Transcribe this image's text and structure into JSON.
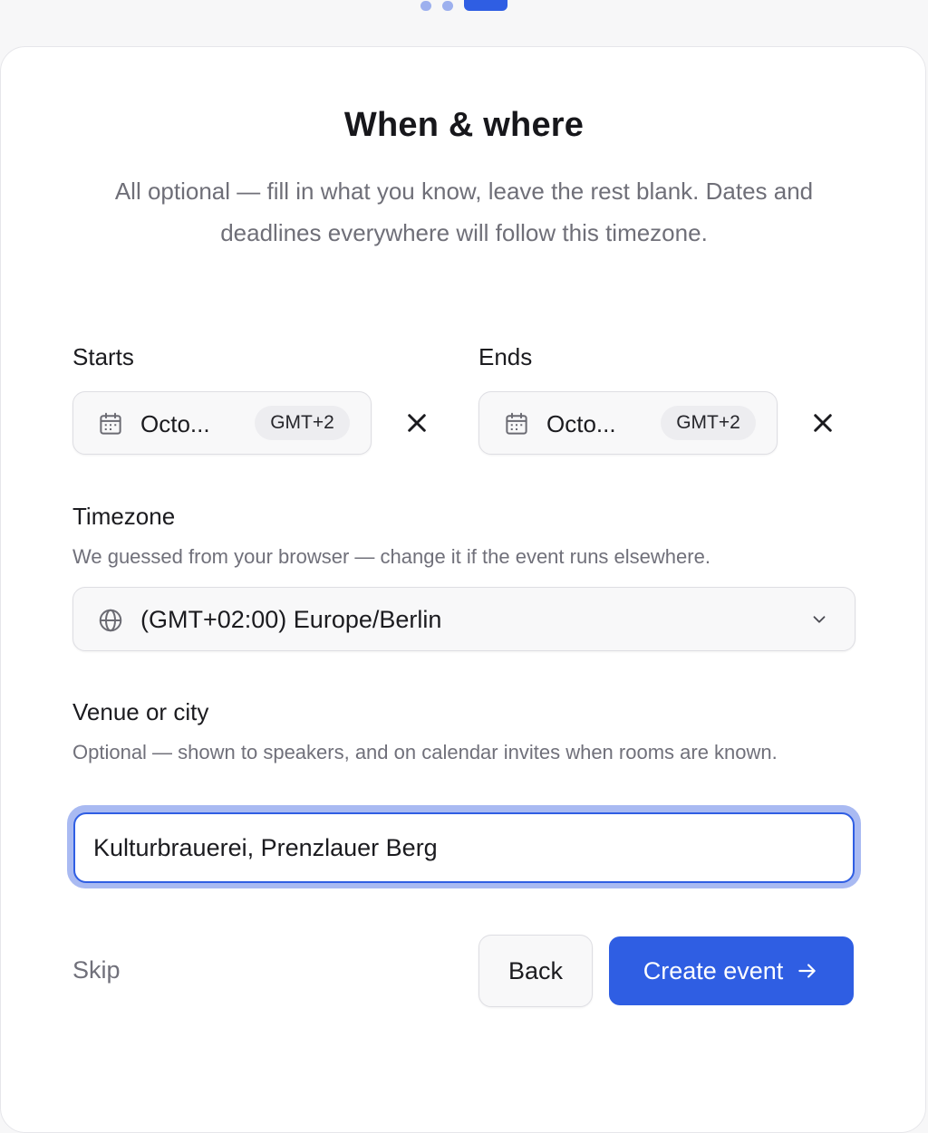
{
  "stepper": {
    "total_steps": 3,
    "current_step": 3
  },
  "page": {
    "title": "When & where",
    "subtitle": "All optional — fill in what you know, leave the rest blank. Dates and deadlines everywhere will follow this timezone."
  },
  "starts": {
    "label": "Starts",
    "value": "Octo...",
    "timezone_badge": "GMT+2",
    "icon": "calendar-icon",
    "clear_icon": "close-icon"
  },
  "ends": {
    "label": "Ends",
    "value": "Octo...",
    "timezone_badge": "GMT+2",
    "icon": "calendar-icon",
    "clear_icon": "close-icon"
  },
  "timezone": {
    "label": "Timezone",
    "help": "We guessed from your browser — change it if the event runs elsewhere.",
    "selected": "(GMT+02:00) Europe/Berlin",
    "icon": "globe-icon",
    "dropdown_icon": "chevron-down-icon"
  },
  "venue": {
    "label": "Venue or city",
    "help": "Optional — shown to speakers, and on calendar invites when rooms are known.",
    "value": "Kulturbrauerei, Prenzlauer Berg"
  },
  "actions": {
    "skip_label": "Skip",
    "back_label": "Back",
    "create_label": "Create event",
    "create_icon": "arrow-right-icon"
  },
  "colors": {
    "accent": "#2f5ee3",
    "accent_light": "#9db0ee",
    "focus_ring": "#a9baf2",
    "muted_text": "#70707a",
    "field_bg": "#f8f8f9",
    "border": "#dedee3"
  }
}
